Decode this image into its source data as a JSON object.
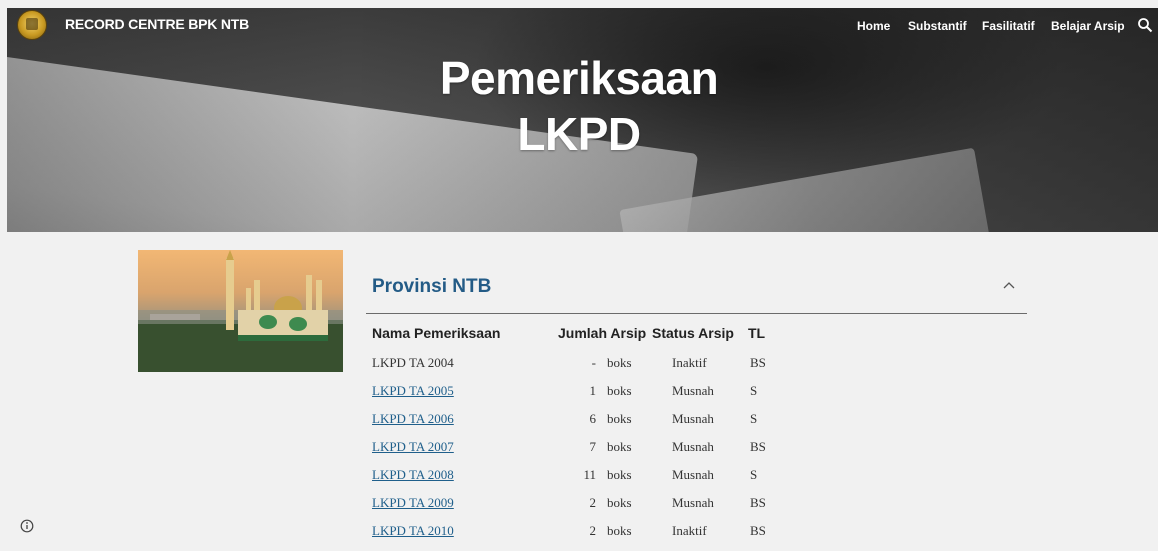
{
  "header": {
    "site_title": "RECORD CENTRE BPK NTB",
    "nav": [
      "Home",
      "Substantif",
      "Fasilitatif",
      "Belajar Arsip"
    ],
    "search_icon": "search-icon",
    "logo_icon": "bpk-emblem"
  },
  "hero": {
    "title_line1": "Pemeriksaan",
    "title_line2": "LKPD"
  },
  "section": {
    "title": "Provinsi NTB",
    "collapse_icon": "chevron-up-icon"
  },
  "table": {
    "headers": [
      "Nama Pemeriksaan",
      "Jumlah Arsip",
      "Status Arsip",
      "TL"
    ],
    "rows": [
      {
        "name": "LKPD TA 2004",
        "count": "-",
        "unit": "boks",
        "status": "Inaktif",
        "tl": "BS",
        "link": false
      },
      {
        "name": "LKPD TA 2005",
        "count": "1",
        "unit": "boks",
        "status": "Musnah",
        "tl": "S",
        "link": true
      },
      {
        "name": "LKPD TA 2006",
        "count": "6",
        "unit": "boks",
        "status": "Musnah",
        "tl": "S",
        "link": true
      },
      {
        "name": "LKPD TA 2007",
        "count": "7",
        "unit": "boks",
        "status": "Musnah",
        "tl": "BS",
        "link": true
      },
      {
        "name": "LKPD TA 2008",
        "count": "11",
        "unit": "boks",
        "status": "Musnah",
        "tl": "S",
        "link": true
      },
      {
        "name": "LKPD TA 2009",
        "count": "2",
        "unit": "boks",
        "status": "Musnah",
        "tl": "BS",
        "link": true
      },
      {
        "name": "LKPD TA 2010",
        "count": "2",
        "unit": "boks",
        "status": "Inaktif",
        "tl": "BS",
        "link": true
      }
    ]
  },
  "colors": {
    "title_blue": "#235b86",
    "link_blue": "#1f5f8b",
    "background": "#f1f1f1"
  }
}
